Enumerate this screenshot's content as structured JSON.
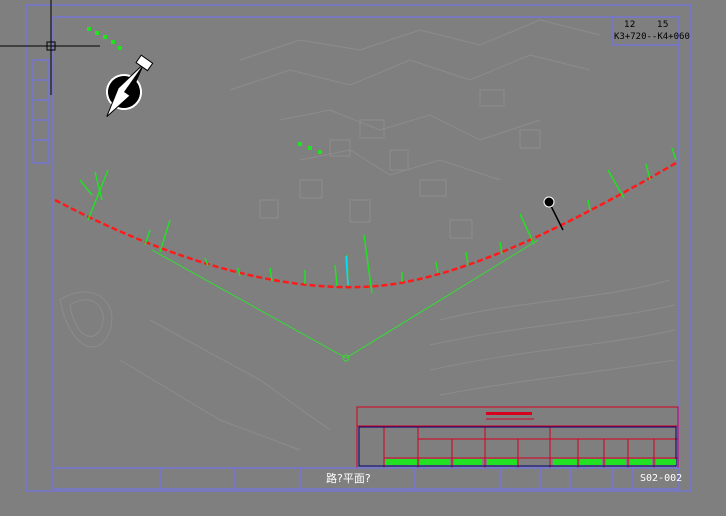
{
  "header": {
    "page_number": "12",
    "page_total": "15",
    "chainage_range": "K3+720--K4+060"
  },
  "title_block": {
    "drawing_title": "路?平面?",
    "sheet_number": "S02-002"
  },
  "colors": {
    "background": "#7f7f7f",
    "frame": "#7070ff",
    "alignment": "#ff1a1a",
    "annotation": "#22e022",
    "tangent": "#33dd33",
    "table_border": "#d6001f"
  },
  "icons": {
    "north_arrow": "compass-north-icon",
    "crosshair": "cad-crosshair-icon"
  }
}
